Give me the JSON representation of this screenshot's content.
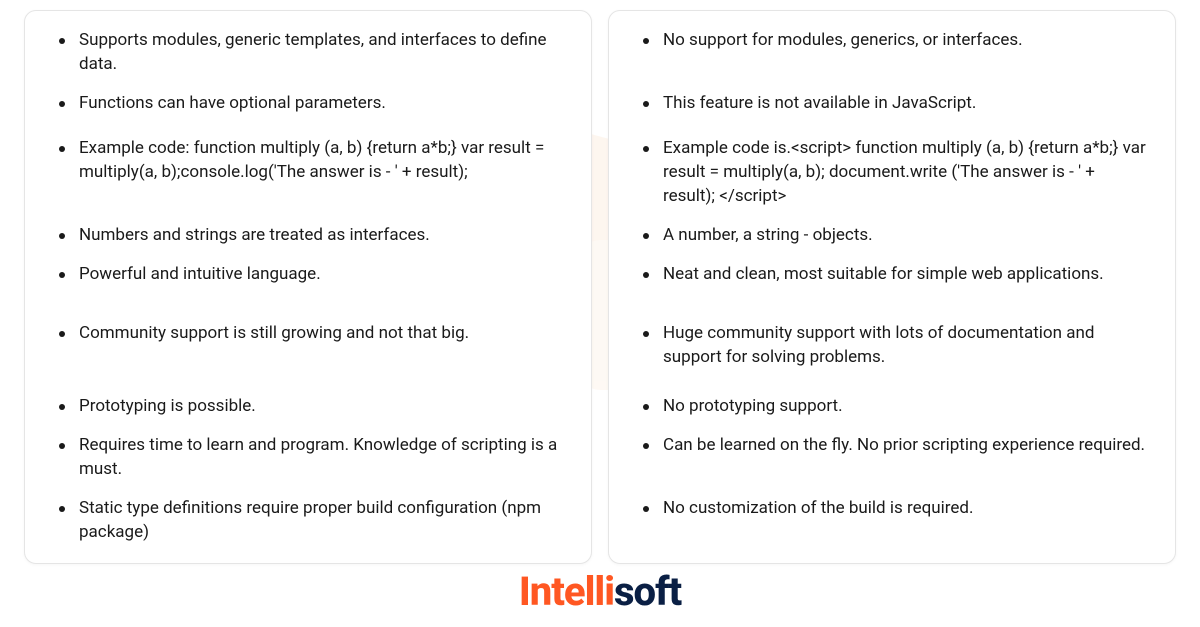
{
  "left_column": {
    "items": [
      "Supports modules, generic templates, and interfaces to define data.",
      "Functions can have optional parameters.",
      "Example code: function multiply (a, b) {return a*b;} var result = multiply(a, b);console.log('The answer is - ' + result);",
      "Numbers and strings are treated as interfaces.",
      "Powerful and intuitive language.",
      "Community support is still growing and not that big.",
      "Prototyping is possible.",
      "Requires time to learn and program. Knowledge of scripting is a must.",
      "Static type definitions require proper build configuration (npm package)"
    ]
  },
  "right_column": {
    "items": [
      "No support for modules, generics, or interfaces.",
      "This feature is not available in JavaScript.",
      "Example code is.<script> function multiply (a, b) {return a*b;} var result = multiply(a, b); document.write ('The answer is - ' + result); </script>",
      "A number, a string - objects.",
      "Neat and clean, most suitable for simple web applications.",
      "Huge community support with lots of documentation and support for solving problems.",
      "No prototyping support.",
      "Can be learned on the fly. No prior scripting experience required.",
      "No customization of the build is required."
    ]
  },
  "logo": {
    "part1": "Intelli",
    "part2": "soft"
  }
}
